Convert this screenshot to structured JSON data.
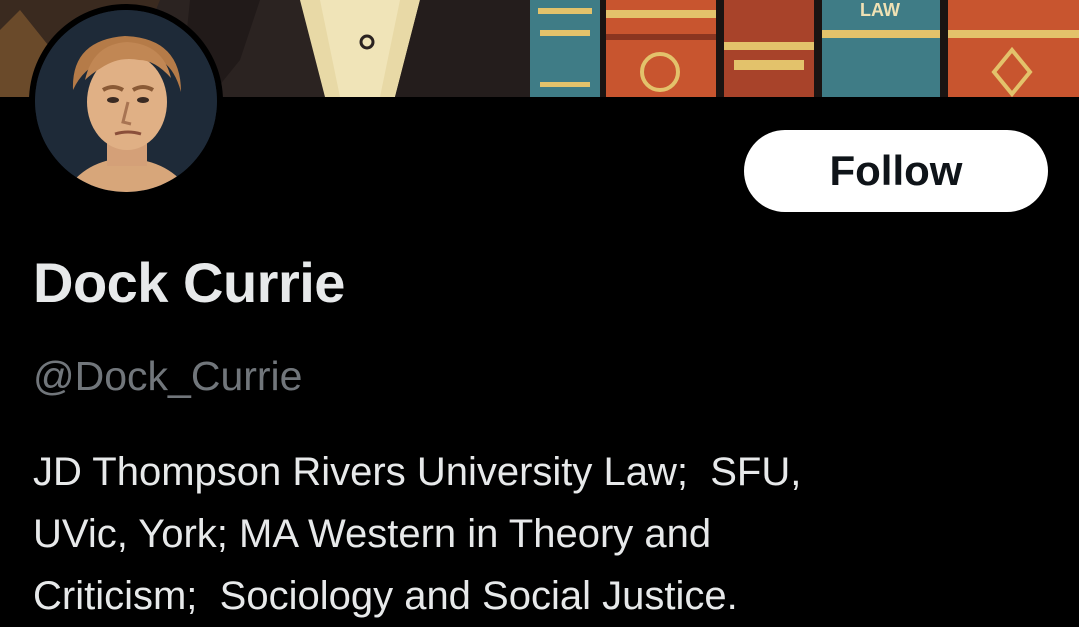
{
  "banner": {
    "spine_label": "LAW",
    "colors": {
      "background": "#2a2220",
      "spine_teal": "#3f7c86",
      "spine_orange": "#c8552f",
      "spine_red": "#a8432a",
      "gold": "#e3c26b",
      "cream": "#efe1b4"
    }
  },
  "profile": {
    "avatar_icon": "profile-portrait",
    "follow_label": "Follow",
    "display_name": "Dock Currie",
    "handle": "@Dock_Currie",
    "bio_lines": [
      "JD Thompson Rivers University Law;  SFU,",
      "UVic, York; MA Western in Theory and",
      "Criticism;  Sociology and Social Justice."
    ]
  },
  "colors": {
    "background": "#000000",
    "primary_text": "#e7e9ea",
    "secondary_text": "#71767b",
    "follow_bg": "#ffffff",
    "follow_text": "#0f1419"
  }
}
